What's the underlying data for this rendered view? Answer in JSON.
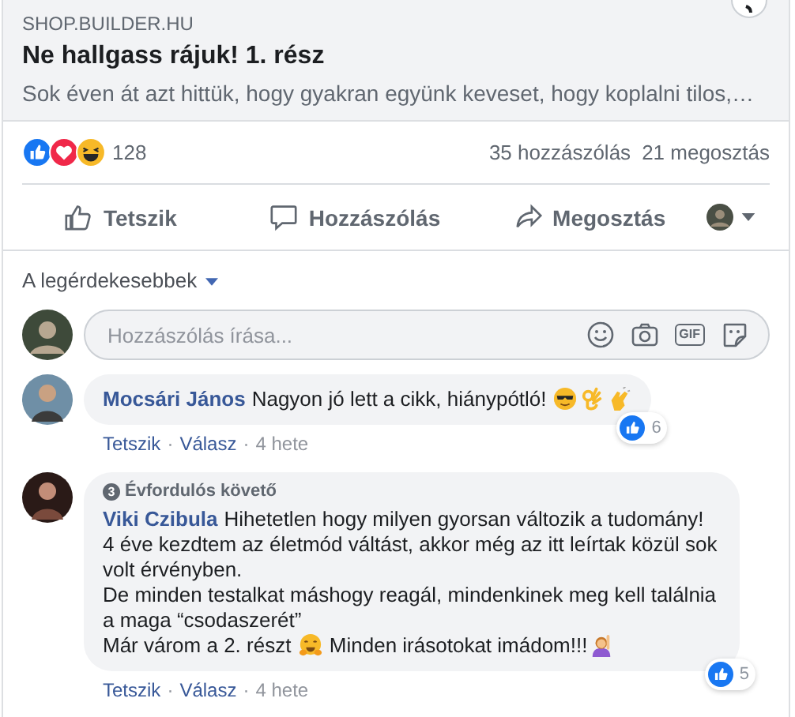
{
  "link_preview": {
    "domain": "SHOP.BUILDER.HU",
    "title": "Ne hallgass rájuk! 1. rész",
    "description": "Sok éven át azt hittük, hogy gyakran együnk keveset, hogy koplalni tilos,…"
  },
  "reactions": {
    "kinds": [
      {
        "kind": "like"
      },
      {
        "kind": "love"
      },
      {
        "kind": "haha"
      }
    ],
    "count": "128",
    "comments": "35 hozzászólás",
    "shares": "21 megosztás"
  },
  "actions": [
    {
      "kind": "like",
      "label": "Tetszik"
    },
    {
      "kind": "comment",
      "label": "Hozzászólás"
    },
    {
      "kind": "share",
      "label": "Megosztás"
    }
  ],
  "sort": {
    "label": "A legérdekesebbek"
  },
  "composer": {
    "placeholder": "Hozzászólás írása...",
    "tools": [
      {
        "kind": "emoji"
      },
      {
        "kind": "camera"
      },
      {
        "kind": "gif",
        "text": "GIF"
      },
      {
        "kind": "sticker"
      }
    ]
  },
  "comments": [
    {
      "author": "Mocsári János",
      "paragraphs": [
        [
          {
            "kind": "text",
            "text": "Nagyon jó lett a cikk, hiánypótló! "
          },
          {
            "kind": "sunglasses"
          },
          {
            "kind": "ok-hand"
          },
          {
            "kind": "clap"
          }
        ]
      ],
      "reaction_count": "6",
      "links": [
        "Tetszik",
        "Válasz"
      ],
      "separator": "·",
      "time": "4 hete"
    },
    {
      "badge": {
        "icon_text": "3",
        "label": "Évfordulós követő"
      },
      "author": "Viki Czibula",
      "paragraphs": [
        [
          {
            "kind": "text",
            "text": "Hihetetlen hogy milyen gyorsan változik a tudomány! 4 éve kezdtem az életmód váltást, akkor még az itt leírtak közül sok volt érvényben."
          }
        ],
        [
          {
            "kind": "text",
            "text": "De minden testalkat máshogy reagál, mindenkinek meg kell találnia a maga “csodaszerét”"
          }
        ],
        [
          {
            "kind": "text",
            "text": "Már várom a 2. részt "
          },
          {
            "kind": "hug"
          },
          {
            "kind": "text",
            "text": " Minden irásotokat imádom!!!"
          },
          {
            "kind": "raised-hand-person"
          }
        ]
      ],
      "reaction_count": "5",
      "links": [
        "Tetszik",
        "Válasz"
      ],
      "separator": "·",
      "time": "4 hete"
    }
  ]
}
